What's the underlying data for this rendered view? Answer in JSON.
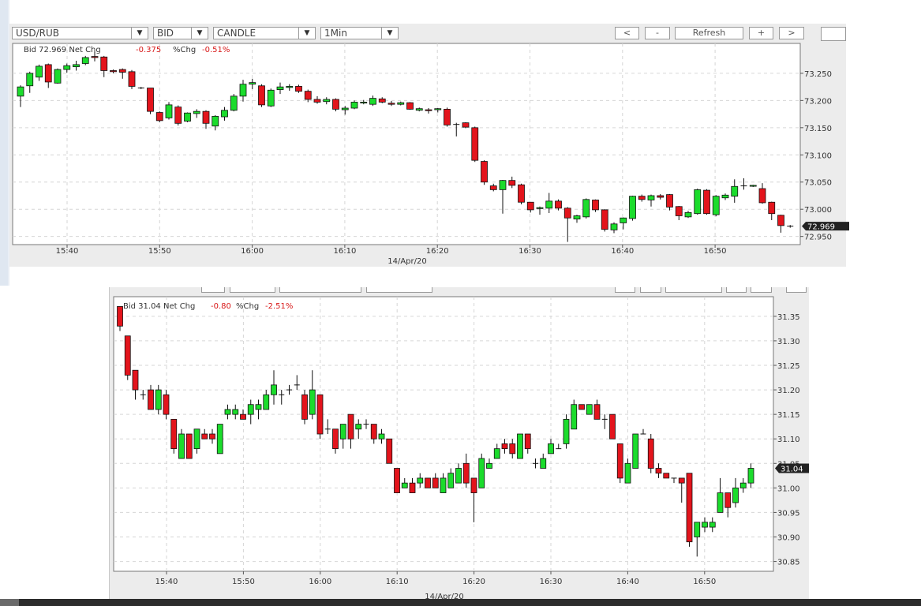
{
  "toolbar": {
    "symbol": "USD/RUB",
    "price_side": "BID",
    "chart_style": "CANDLE",
    "interval": "1Min",
    "prev_label": "<",
    "zoom_out_label": "-",
    "refresh_label": "Refresh",
    "zoom_in_label": "+",
    "next_label": ">"
  },
  "chart_data": [
    {
      "type": "candlestick",
      "header": {
        "prefix": "Bid 72.969 Net Chg",
        "net_chg": "-0.375",
        "pct_label": "%Chg",
        "pct_chg": "-0.51%"
      },
      "date_label": "14/Apr/20",
      "x_ticks": [
        "15:40",
        "15:50",
        "16:00",
        "16:10",
        "16:20",
        "16:30",
        "16:40",
        "16:50"
      ],
      "y_ticks": [
        "73.250",
        "73.200",
        "73.150",
        "73.100",
        "73.050",
        "73.000",
        "72.950"
      ],
      "ylim": [
        72.935,
        73.305
      ],
      "last_price": "72.969",
      "colors": {
        "up": "#1bdc2c",
        "down": "#e3141c",
        "neg_text": "#d81818"
      },
      "candles": [
        [
          73.208,
          73.225,
          73.188,
          73.228
        ],
        [
          73.227,
          73.25,
          73.214,
          73.253
        ],
        [
          73.243,
          73.263,
          73.236,
          73.266
        ],
        [
          73.266,
          73.234,
          73.223,
          73.268
        ],
        [
          73.232,
          73.257,
          73.231,
          73.259
        ],
        [
          73.257,
          73.264,
          73.251,
          73.268
        ],
        [
          73.262,
          73.266,
          73.255,
          73.273
        ],
        [
          73.268,
          73.279,
          73.265,
          73.282
        ],
        [
          73.281,
          73.279,
          73.272,
          73.292
        ],
        [
          73.28,
          73.255,
          73.243,
          73.282
        ],
        [
          73.255,
          73.253,
          73.25,
          73.257
        ],
        [
          73.257,
          73.252,
          73.24,
          73.259
        ],
        [
          73.253,
          73.226,
          73.221,
          73.256
        ],
        [
          73.223,
          73.223,
          73.221,
          73.225
        ],
        [
          73.223,
          73.18,
          73.175,
          73.223
        ],
        [
          73.178,
          73.163,
          73.16,
          73.18
        ],
        [
          73.168,
          73.192,
          73.165,
          73.197
        ],
        [
          73.188,
          73.158,
          73.154,
          73.191
        ],
        [
          73.162,
          73.177,
          73.16,
          73.178
        ],
        [
          73.176,
          73.18,
          73.168,
          73.184
        ],
        [
          73.18,
          73.158,
          73.148,
          73.182
        ],
        [
          73.153,
          73.171,
          73.145,
          73.173
        ],
        [
          73.17,
          73.182,
          73.163,
          73.188
        ],
        [
          73.182,
          73.208,
          73.18,
          73.212
        ],
        [
          73.208,
          73.23,
          73.198,
          73.238
        ],
        [
          73.23,
          73.233,
          73.221,
          73.24
        ],
        [
          73.227,
          73.192,
          73.188,
          73.23
        ],
        [
          73.19,
          73.219,
          73.188,
          73.222
        ],
        [
          73.22,
          73.225,
          73.212,
          73.233
        ],
        [
          73.224,
          73.226,
          73.218,
          73.23
        ],
        [
          73.226,
          73.217,
          73.214,
          73.229
        ],
        [
          73.217,
          73.202,
          73.197,
          73.22
        ],
        [
          73.202,
          73.197,
          73.194,
          73.208
        ],
        [
          73.198,
          73.202,
          73.193,
          73.206
        ],
        [
          73.202,
          73.184,
          73.18,
          73.204
        ],
        [
          73.183,
          73.186,
          73.174,
          73.19
        ],
        [
          73.186,
          73.197,
          73.184,
          73.2
        ],
        [
          73.196,
          73.197,
          73.193,
          73.201
        ],
        [
          73.193,
          73.204,
          73.19,
          73.209
        ],
        [
          73.203,
          73.197,
          73.195,
          73.206
        ],
        [
          73.195,
          73.193,
          73.19,
          73.199
        ],
        [
          73.193,
          73.196,
          73.191,
          73.198
        ],
        [
          73.196,
          73.184,
          73.183,
          73.197
        ],
        [
          73.182,
          73.185,
          73.18,
          73.187
        ],
        [
          73.183,
          73.182,
          73.176,
          73.186
        ],
        [
          73.183,
          73.185,
          73.178,
          73.186
        ],
        [
          73.184,
          73.155,
          73.152,
          73.187
        ],
        [
          73.156,
          73.156,
          73.134,
          73.159
        ],
        [
          73.159,
          73.151,
          73.149,
          73.16
        ],
        [
          73.15,
          73.09,
          73.087,
          73.152
        ],
        [
          73.088,
          73.05,
          73.045,
          73.09
        ],
        [
          73.043,
          73.036,
          73.033,
          73.047
        ],
        [
          73.036,
          73.053,
          72.992,
          73.054
        ],
        [
          73.053,
          73.044,
          73.039,
          73.06
        ],
        [
          73.045,
          73.013,
          73.009,
          73.047
        ],
        [
          73.013,
          72.999,
          72.994,
          73.013
        ],
        [
          73.002,
          73.003,
          72.99,
          73.005
        ],
        [
          73.002,
          73.015,
          72.993,
          73.03
        ],
        [
          73.015,
          73.002,
          72.998,
          73.018
        ],
        [
          73.002,
          72.984,
          72.94,
          73.004
        ],
        [
          72.982,
          72.988,
          72.975,
          72.99
        ],
        [
          72.986,
          73.018,
          72.983,
          73.02
        ],
        [
          73.017,
          72.999,
          72.995,
          73.018
        ],
        [
          72.999,
          72.963,
          72.959,
          73.0
        ],
        [
          72.962,
          72.973,
          72.956,
          72.976
        ],
        [
          72.975,
          72.984,
          72.963,
          72.985
        ],
        [
          72.983,
          73.024,
          72.979,
          73.025
        ],
        [
          73.024,
          73.018,
          73.014,
          73.027
        ],
        [
          73.017,
          73.025,
          73.005,
          73.027
        ],
        [
          73.025,
          73.022,
          73.018,
          73.028
        ],
        [
          73.027,
          73.004,
          72.998,
          73.028
        ],
        [
          73.005,
          72.988,
          72.98,
          73.006
        ],
        [
          72.986,
          72.994,
          72.984,
          72.997
        ],
        [
          72.992,
          73.036,
          72.99,
          73.038
        ],
        [
          73.035,
          72.992,
          72.99,
          73.037
        ],
        [
          72.99,
          73.024,
          72.987,
          73.026
        ],
        [
          73.021,
          73.026,
          73.017,
          73.029
        ],
        [
          73.024,
          73.042,
          73.012,
          73.055
        ],
        [
          73.043,
          73.043,
          73.036,
          73.057
        ],
        [
          73.043,
          73.044,
          73.041,
          73.045
        ],
        [
          73.038,
          73.012,
          73.01,
          73.048
        ],
        [
          73.013,
          72.992,
          72.98,
          73.014
        ],
        [
          72.989,
          72.97,
          72.957,
          72.99
        ],
        [
          72.969,
          72.969,
          72.966,
          72.971
        ]
      ]
    },
    {
      "type": "candlestick",
      "header": {
        "prefix": "Bid 31.04 Net Chg",
        "net_chg": "-0.80",
        "pct_label": "%Chg",
        "pct_chg": "-2.51%"
      },
      "date_label": "14/Apr/20",
      "x_ticks": [
        "15:40",
        "15:50",
        "16:00",
        "16:10",
        "16:20",
        "16:30",
        "16:40",
        "16:50"
      ],
      "y_ticks": [
        "31.35",
        "31.30",
        "31.25",
        "31.20",
        "31.15",
        "31.10",
        "31.05",
        "31.00",
        "30.95",
        "30.90",
        "30.85"
      ],
      "ylim": [
        30.83,
        31.39
      ],
      "last_price": "31.04",
      "colors": {
        "up": "#1bdc2c",
        "down": "#e3141c",
        "neg_text": "#d81818"
      },
      "candles": [
        [
          31.37,
          31.33,
          31.32,
          31.37
        ],
        [
          31.31,
          31.23,
          31.22,
          31.31
        ],
        [
          31.24,
          31.2,
          31.18,
          31.24
        ],
        [
          31.19,
          31.19,
          31.18,
          31.2
        ],
        [
          31.2,
          31.16,
          31.16,
          31.21
        ],
        [
          31.16,
          31.2,
          31.15,
          31.21
        ],
        [
          31.19,
          31.15,
          31.14,
          31.2
        ],
        [
          31.14,
          31.08,
          31.07,
          31.14
        ],
        [
          31.06,
          31.11,
          31.06,
          31.12
        ],
        [
          31.11,
          31.06,
          31.06,
          31.11
        ],
        [
          31.08,
          31.12,
          31.07,
          31.12
        ],
        [
          31.11,
          31.1,
          31.1,
          31.12
        ],
        [
          31.11,
          31.1,
          31.09,
          31.12
        ],
        [
          31.07,
          31.13,
          31.07,
          31.13
        ],
        [
          31.15,
          31.16,
          31.14,
          31.17
        ],
        [
          31.15,
          31.16,
          31.14,
          31.17
        ],
        [
          31.15,
          31.14,
          31.14,
          31.16
        ],
        [
          31.15,
          31.17,
          31.13,
          31.18
        ],
        [
          31.16,
          31.17,
          31.14,
          31.18
        ],
        [
          31.16,
          31.19,
          31.16,
          31.2
        ],
        [
          31.19,
          31.21,
          31.17,
          31.24
        ],
        [
          31.19,
          31.19,
          31.17,
          31.2
        ],
        [
          31.2,
          31.2,
          31.19,
          31.21
        ],
        [
          31.21,
          31.21,
          31.2,
          31.23
        ],
        [
          31.19,
          31.14,
          31.13,
          31.2
        ],
        [
          31.15,
          31.2,
          31.14,
          31.24
        ],
        [
          31.19,
          31.11,
          31.1,
          31.19
        ],
        [
          31.12,
          31.12,
          31.11,
          31.14
        ],
        [
          31.12,
          31.08,
          31.07,
          31.12
        ],
        [
          31.1,
          31.13,
          31.08,
          31.13
        ],
        [
          31.15,
          31.1,
          31.08,
          31.15
        ],
        [
          31.12,
          31.13,
          31.1,
          31.14
        ],
        [
          31.13,
          31.13,
          31.12,
          31.14
        ],
        [
          31.13,
          31.1,
          31.09,
          31.13
        ],
        [
          31.1,
          31.11,
          31.09,
          31.12
        ],
        [
          31.1,
          31.05,
          31.05,
          31.1
        ],
        [
          31.04,
          30.99,
          30.99,
          31.04
        ],
        [
          31.0,
          31.01,
          31.0,
          31.02
        ],
        [
          31.01,
          30.99,
          30.99,
          31.02
        ],
        [
          31.01,
          31.02,
          31.0,
          31.03
        ],
        [
          31.02,
          31.0,
          31.0,
          31.02
        ],
        [
          31.02,
          31.0,
          31.0,
          31.03
        ],
        [
          30.99,
          31.02,
          30.99,
          31.03
        ],
        [
          31.0,
          31.03,
          31.0,
          31.04
        ],
        [
          31.01,
          31.04,
          31.01,
          31.05
        ],
        [
          31.05,
          31.01,
          31.0,
          31.07
        ],
        [
          31.02,
          30.99,
          30.93,
          31.02
        ],
        [
          31.0,
          31.06,
          31.0,
          31.07
        ],
        [
          31.04,
          31.05,
          31.04,
          31.06
        ],
        [
          31.06,
          31.08,
          31.06,
          31.09
        ],
        [
          31.09,
          31.08,
          31.07,
          31.1
        ],
        [
          31.09,
          31.07,
          31.06,
          31.1
        ],
        [
          31.06,
          31.11,
          31.06,
          31.11
        ],
        [
          31.11,
          31.08,
          31.07,
          31.11
        ],
        [
          31.05,
          31.05,
          31.04,
          31.06
        ],
        [
          31.04,
          31.06,
          31.04,
          31.07
        ],
        [
          31.07,
          31.09,
          31.07,
          31.1
        ],
        [
          31.08,
          31.08,
          31.08,
          31.09
        ],
        [
          31.09,
          31.14,
          31.08,
          31.15
        ],
        [
          31.12,
          31.17,
          31.12,
          31.18
        ],
        [
          31.17,
          31.16,
          31.16,
          31.17
        ],
        [
          31.15,
          31.17,
          31.15,
          31.17
        ],
        [
          31.17,
          31.14,
          31.14,
          31.18
        ],
        [
          31.14,
          31.14,
          31.12,
          31.15
        ],
        [
          31.15,
          31.1,
          31.1,
          31.15
        ],
        [
          31.09,
          31.02,
          31.01,
          31.09
        ],
        [
          31.01,
          31.05,
          31.01,
          31.06
        ],
        [
          31.04,
          31.11,
          31.04,
          31.11
        ],
        [
          31.11,
          31.11,
          31.11,
          31.12
        ],
        [
          31.1,
          31.04,
          31.03,
          31.11
        ],
        [
          31.04,
          31.03,
          31.02,
          31.05
        ],
        [
          31.03,
          31.02,
          31.02,
          31.03
        ],
        [
          31.02,
          31.02,
          31.01,
          31.02
        ],
        [
          31.02,
          31.01,
          30.97,
          31.02
        ],
        [
          31.03,
          30.89,
          30.88,
          31.03
        ],
        [
          30.9,
          30.93,
          30.86,
          30.93
        ],
        [
          30.92,
          30.93,
          30.91,
          30.94
        ],
        [
          30.92,
          30.93,
          30.91,
          30.94
        ],
        [
          30.95,
          30.99,
          30.95,
          31.02
        ],
        [
          30.99,
          30.96,
          30.94,
          30.99
        ],
        [
          30.97,
          31.0,
          30.96,
          31.02
        ],
        [
          31.0,
          31.01,
          30.99,
          31.02
        ],
        [
          31.01,
          31.04,
          31.0,
          31.05
        ]
      ]
    }
  ]
}
